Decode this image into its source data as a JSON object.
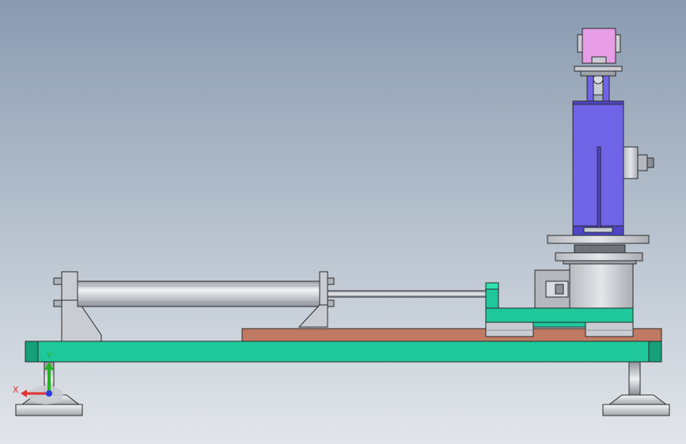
{
  "viewport": {
    "background_top": "#8a9bb0",
    "background_bottom": "#e2e6ea"
  },
  "colors": {
    "base_frame": "#1fc89a",
    "base_frame_dark": "#16a07a",
    "rail_plate": "#c07a63",
    "carriage": "#1fc89a",
    "column_body": "#6f63e6",
    "column_body_dark": "#4f45c6",
    "motor_top": "#e79ee6",
    "steel": "#c9ccd2",
    "steel_dark": "#8c9097",
    "cylinder": "#d8dbe0",
    "outline": "#2a2a2a"
  },
  "triad": {
    "x_label": "X",
    "y_label": "Y",
    "x_axis_color": "#e23232",
    "y_axis_color": "#22b422",
    "z_axis_color": "#2a3cd6"
  },
  "parts": {
    "base_frame": "base-frame",
    "left_foot": "leveling-foot-left",
    "right_foot": "leveling-foot-right",
    "rail_plate": "linear-rail-plate",
    "cylinder": "pneumatic-cylinder",
    "piston_rod": "piston-rod",
    "carriage": "sliding-carriage",
    "rotary_table": "rotary-table",
    "column": "lift-column",
    "side_valve": "side-port-fitting",
    "top_motor": "top-motor-housing"
  }
}
